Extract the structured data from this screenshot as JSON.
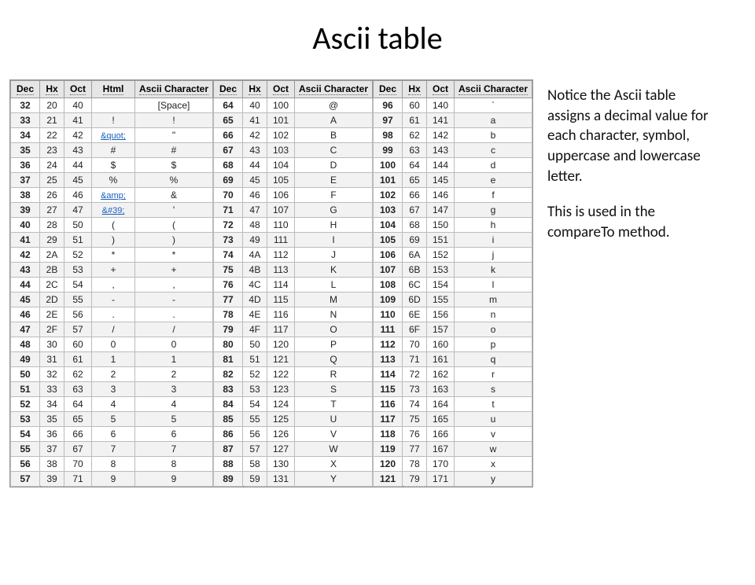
{
  "title": "Ascii table",
  "side": {
    "p1": "Notice the Ascii table assigns a decimal value for each character, symbol, uppercase and lowercase letter.",
    "p2": "This is used in the compareTo method."
  },
  "headers": {
    "dec": "Dec",
    "hx": "Hx",
    "oct": "Oct",
    "html": "Html",
    "chr": "Ascii Character"
  },
  "col1": [
    {
      "dec": "32",
      "hx": "20",
      "oct": "40",
      "html": "",
      "chr": "[Space]"
    },
    {
      "dec": "33",
      "hx": "21",
      "oct": "41",
      "html": "!",
      "chr": "!"
    },
    {
      "dec": "34",
      "hx": "22",
      "oct": "42",
      "html": "&quot;",
      "chr": "\"",
      "link": true
    },
    {
      "dec": "35",
      "hx": "23",
      "oct": "43",
      "html": "#",
      "chr": "#"
    },
    {
      "dec": "36",
      "hx": "24",
      "oct": "44",
      "html": "$",
      "chr": "$"
    },
    {
      "dec": "37",
      "hx": "25",
      "oct": "45",
      "html": "%",
      "chr": "%"
    },
    {
      "dec": "38",
      "hx": "26",
      "oct": "46",
      "html": "&amp;",
      "chr": "&",
      "link": true
    },
    {
      "dec": "39",
      "hx": "27",
      "oct": "47",
      "html": "&#39;",
      "chr": "'",
      "link": true
    },
    {
      "dec": "40",
      "hx": "28",
      "oct": "50",
      "html": "(",
      "chr": "("
    },
    {
      "dec": "41",
      "hx": "29",
      "oct": "51",
      "html": ")",
      "chr": ")"
    },
    {
      "dec": "42",
      "hx": "2A",
      "oct": "52",
      "html": "*",
      "chr": "*"
    },
    {
      "dec": "43",
      "hx": "2B",
      "oct": "53",
      "html": "+",
      "chr": "+"
    },
    {
      "dec": "44",
      "hx": "2C",
      "oct": "54",
      "html": ",",
      "chr": ","
    },
    {
      "dec": "45",
      "hx": "2D",
      "oct": "55",
      "html": "-",
      "chr": "-"
    },
    {
      "dec": "46",
      "hx": "2E",
      "oct": "56",
      "html": ".",
      "chr": "."
    },
    {
      "dec": "47",
      "hx": "2F",
      "oct": "57",
      "html": "/",
      "chr": "/"
    },
    {
      "dec": "48",
      "hx": "30",
      "oct": "60",
      "html": "0",
      "chr": "0"
    },
    {
      "dec": "49",
      "hx": "31",
      "oct": "61",
      "html": "1",
      "chr": "1"
    },
    {
      "dec": "50",
      "hx": "32",
      "oct": "62",
      "html": "2",
      "chr": "2"
    },
    {
      "dec": "51",
      "hx": "33",
      "oct": "63",
      "html": "3",
      "chr": "3"
    },
    {
      "dec": "52",
      "hx": "34",
      "oct": "64",
      "html": "4",
      "chr": "4"
    },
    {
      "dec": "53",
      "hx": "35",
      "oct": "65",
      "html": "5",
      "chr": "5"
    },
    {
      "dec": "54",
      "hx": "36",
      "oct": "66",
      "html": "6",
      "chr": "6"
    },
    {
      "dec": "55",
      "hx": "37",
      "oct": "67",
      "html": "7",
      "chr": "7"
    },
    {
      "dec": "56",
      "hx": "38",
      "oct": "70",
      "html": "8",
      "chr": "8"
    },
    {
      "dec": "57",
      "hx": "39",
      "oct": "71",
      "html": "9",
      "chr": "9"
    }
  ],
  "col2": [
    {
      "dec": "64",
      "hx": "40",
      "oct": "100",
      "chr": "@"
    },
    {
      "dec": "65",
      "hx": "41",
      "oct": "101",
      "chr": "A"
    },
    {
      "dec": "66",
      "hx": "42",
      "oct": "102",
      "chr": "B"
    },
    {
      "dec": "67",
      "hx": "43",
      "oct": "103",
      "chr": "C"
    },
    {
      "dec": "68",
      "hx": "44",
      "oct": "104",
      "chr": "D"
    },
    {
      "dec": "69",
      "hx": "45",
      "oct": "105",
      "chr": "E"
    },
    {
      "dec": "70",
      "hx": "46",
      "oct": "106",
      "chr": "F"
    },
    {
      "dec": "71",
      "hx": "47",
      "oct": "107",
      "chr": "G"
    },
    {
      "dec": "72",
      "hx": "48",
      "oct": "110",
      "chr": "H"
    },
    {
      "dec": "73",
      "hx": "49",
      "oct": "111",
      "chr": "I"
    },
    {
      "dec": "74",
      "hx": "4A",
      "oct": "112",
      "chr": "J"
    },
    {
      "dec": "75",
      "hx": "4B",
      "oct": "113",
      "chr": "K"
    },
    {
      "dec": "76",
      "hx": "4C",
      "oct": "114",
      "chr": "L"
    },
    {
      "dec": "77",
      "hx": "4D",
      "oct": "115",
      "chr": "M"
    },
    {
      "dec": "78",
      "hx": "4E",
      "oct": "116",
      "chr": "N"
    },
    {
      "dec": "79",
      "hx": "4F",
      "oct": "117",
      "chr": "O"
    },
    {
      "dec": "80",
      "hx": "50",
      "oct": "120",
      "chr": "P"
    },
    {
      "dec": "81",
      "hx": "51",
      "oct": "121",
      "chr": "Q"
    },
    {
      "dec": "82",
      "hx": "52",
      "oct": "122",
      "chr": "R"
    },
    {
      "dec": "83",
      "hx": "53",
      "oct": "123",
      "chr": "S"
    },
    {
      "dec": "84",
      "hx": "54",
      "oct": "124",
      "chr": "T"
    },
    {
      "dec": "85",
      "hx": "55",
      "oct": "125",
      "chr": "U"
    },
    {
      "dec": "86",
      "hx": "56",
      "oct": "126",
      "chr": "V"
    },
    {
      "dec": "87",
      "hx": "57",
      "oct": "127",
      "chr": "W"
    },
    {
      "dec": "88",
      "hx": "58",
      "oct": "130",
      "chr": "X"
    },
    {
      "dec": "89",
      "hx": "59",
      "oct": "131",
      "chr": "Y"
    }
  ],
  "col3": [
    {
      "dec": "96",
      "hx": "60",
      "oct": "140",
      "chr": "`"
    },
    {
      "dec": "97",
      "hx": "61",
      "oct": "141",
      "chr": "a"
    },
    {
      "dec": "98",
      "hx": "62",
      "oct": "142",
      "chr": "b"
    },
    {
      "dec": "99",
      "hx": "63",
      "oct": "143",
      "chr": "c"
    },
    {
      "dec": "100",
      "hx": "64",
      "oct": "144",
      "chr": "d"
    },
    {
      "dec": "101",
      "hx": "65",
      "oct": "145",
      "chr": "e"
    },
    {
      "dec": "102",
      "hx": "66",
      "oct": "146",
      "chr": "f"
    },
    {
      "dec": "103",
      "hx": "67",
      "oct": "147",
      "chr": "g"
    },
    {
      "dec": "104",
      "hx": "68",
      "oct": "150",
      "chr": "h"
    },
    {
      "dec": "105",
      "hx": "69",
      "oct": "151",
      "chr": "i"
    },
    {
      "dec": "106",
      "hx": "6A",
      "oct": "152",
      "chr": "j"
    },
    {
      "dec": "107",
      "hx": "6B",
      "oct": "153",
      "chr": "k"
    },
    {
      "dec": "108",
      "hx": "6C",
      "oct": "154",
      "chr": "l"
    },
    {
      "dec": "109",
      "hx": "6D",
      "oct": "155",
      "chr": "m"
    },
    {
      "dec": "110",
      "hx": "6E",
      "oct": "156",
      "chr": "n"
    },
    {
      "dec": "111",
      "hx": "6F",
      "oct": "157",
      "chr": "o"
    },
    {
      "dec": "112",
      "hx": "70",
      "oct": "160",
      "chr": "p"
    },
    {
      "dec": "113",
      "hx": "71",
      "oct": "161",
      "chr": "q"
    },
    {
      "dec": "114",
      "hx": "72",
      "oct": "162",
      "chr": "r"
    },
    {
      "dec": "115",
      "hx": "73",
      "oct": "163",
      "chr": "s"
    },
    {
      "dec": "116",
      "hx": "74",
      "oct": "164",
      "chr": "t"
    },
    {
      "dec": "117",
      "hx": "75",
      "oct": "165",
      "chr": "u"
    },
    {
      "dec": "118",
      "hx": "76",
      "oct": "166",
      "chr": "v"
    },
    {
      "dec": "119",
      "hx": "77",
      "oct": "167",
      "chr": "w"
    },
    {
      "dec": "120",
      "hx": "78",
      "oct": "170",
      "chr": "x"
    },
    {
      "dec": "121",
      "hx": "79",
      "oct": "171",
      "chr": "y"
    }
  ]
}
